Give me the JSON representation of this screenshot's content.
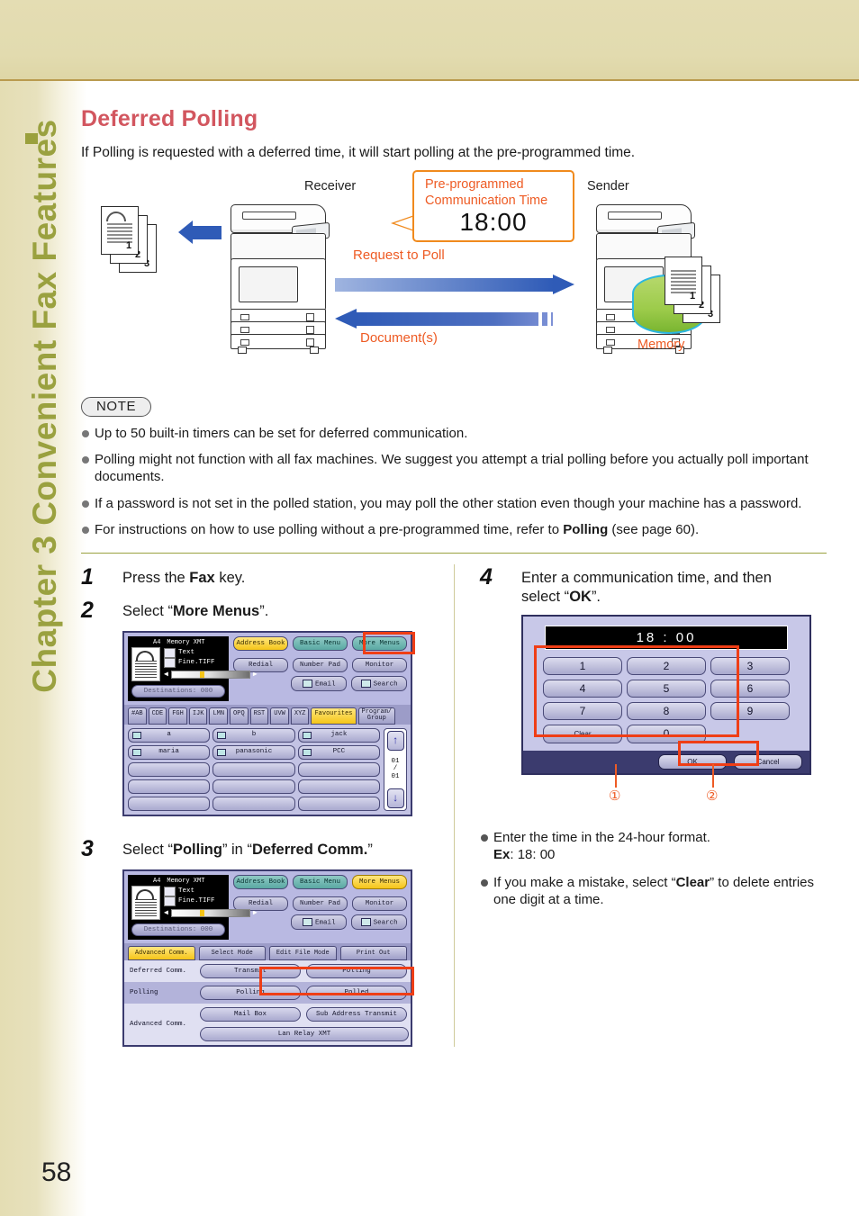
{
  "sidebar": {
    "chapter_title": "Chapter 3  Convenient Fax Features",
    "page_number": "58"
  },
  "header": {
    "title": "Deferred Polling",
    "intro": "If Polling is requested with a deferred time, it will start polling at the pre-programmed time.",
    "title_color": "#d2565f"
  },
  "diagram": {
    "receiver_label": "Receiver",
    "sender_label": "Sender",
    "callout_line1": "Pre-programmed",
    "callout_line2": "Communication Time",
    "callout_time": "18:00",
    "request_label": "Request to Poll",
    "document_label": "Document(s)",
    "memory_label": "Memory",
    "page_numbers": [
      "1",
      "2",
      "3"
    ],
    "accent_orange": "#ee5b24",
    "arrow_blue": "#2f5bb7"
  },
  "note": {
    "tag": "NOTE",
    "items": [
      "Up to 50 built-in timers can be set for deferred communication.",
      "Polling might not function with all fax machines. We suggest you attempt a trial polling before you actually poll important documents.",
      "If a password is not set in the polled station, you may poll the other station even though your machine has a password.",
      "For instructions on how to use polling without a pre-programmed time, refer to Polling (see page 60)."
    ],
    "item4_bold": "Polling",
    "item4_pre": "For instructions on how to use polling without a pre-programmed time, refer to ",
    "item4_post": " (see page 60)."
  },
  "steps": {
    "step1": {
      "number": "1",
      "pre": "Press the ",
      "bold": "Fax",
      "post": " key."
    },
    "step2": {
      "number": "2",
      "pre": "Select “",
      "bold": "More Menus",
      "post": "”."
    },
    "step3": {
      "number": "3",
      "pre": "Select “",
      "bold": "Polling",
      "mid": "” in “",
      "bold2": "Deferred Comm.",
      "post": "”"
    },
    "step4": {
      "number": "4",
      "line1": "Enter a communication time, and then",
      "line2_pre": "select “",
      "line2_bold": "OK",
      "line2_post": "”."
    }
  },
  "lcd_fax": {
    "doc": {
      "paper_size": "A4",
      "mode": "Memory XMT",
      "text_mode": "Text",
      "resolution": "Fine.TIFF",
      "destinations": "Destinations: 000"
    },
    "top_buttons": [
      "Address Book",
      "Basic Menu",
      "More Menus"
    ],
    "mid_buttons": [
      "Redial",
      "Number Pad",
      "Monitor"
    ],
    "bottom_buttons": [
      "Email",
      "Search"
    ],
    "selected_top_step2": "Address Book",
    "selected_top_step3": "More Menus"
  },
  "address_book": {
    "tabs": [
      "#AB",
      "CDE",
      "FGH",
      "IJK",
      "LMN",
      "OPQ",
      "RST",
      "UVW",
      "XYZ",
      "Favourites"
    ],
    "active_tab": "Favourites",
    "program_tab_line1": "Program/",
    "program_tab_line2": "Group",
    "entries": [
      "a",
      "b",
      "jack",
      "maria",
      "panasonic",
      "PCC"
    ],
    "page_counter": {
      "current": "01",
      "sep": "/",
      "total": "01"
    },
    "up_arrow": "↑",
    "down_arrow": "↓"
  },
  "advanced_comm": {
    "tabs": [
      "Advanced Comm.",
      "Select Mode",
      "Edit File Mode",
      "Print Out"
    ],
    "active_tab": "Advanced Comm.",
    "rows": [
      {
        "label": "Deferred Comm.",
        "buttons": [
          "Transmit",
          "Polling"
        ]
      },
      {
        "label": "Polling",
        "buttons": [
          "Polling",
          "Polled"
        ]
      },
      {
        "label": "Advanced Comm.",
        "buttons": [
          "Mail Box",
          "Sub Address Transmit",
          "Lan Relay XMT"
        ]
      }
    ],
    "highlighted_button": "Polling"
  },
  "keypad": {
    "display": "18 : 00",
    "keys": [
      "1",
      "2",
      "3",
      "4",
      "5",
      "6",
      "7",
      "8",
      "9",
      "Clear",
      "0"
    ],
    "ok_label": "OK",
    "cancel_label": "Cancel",
    "callout1": "①",
    "callout2": "②",
    "notes": [
      {
        "pre": "Enter the time in the 24-hour format.",
        "bold": "Ex",
        "post": ": 18: 00"
      },
      {
        "pre": "If you make a mistake, select “",
        "bold": "Clear",
        "post": "” to delete entries one digit at a time."
      }
    ]
  },
  "colors": {
    "band_beige": "#e2dbaf",
    "olive": "#9aa13f",
    "highlight_red": "#ef3e16",
    "lcd_bg": "#c8c8e8"
  }
}
